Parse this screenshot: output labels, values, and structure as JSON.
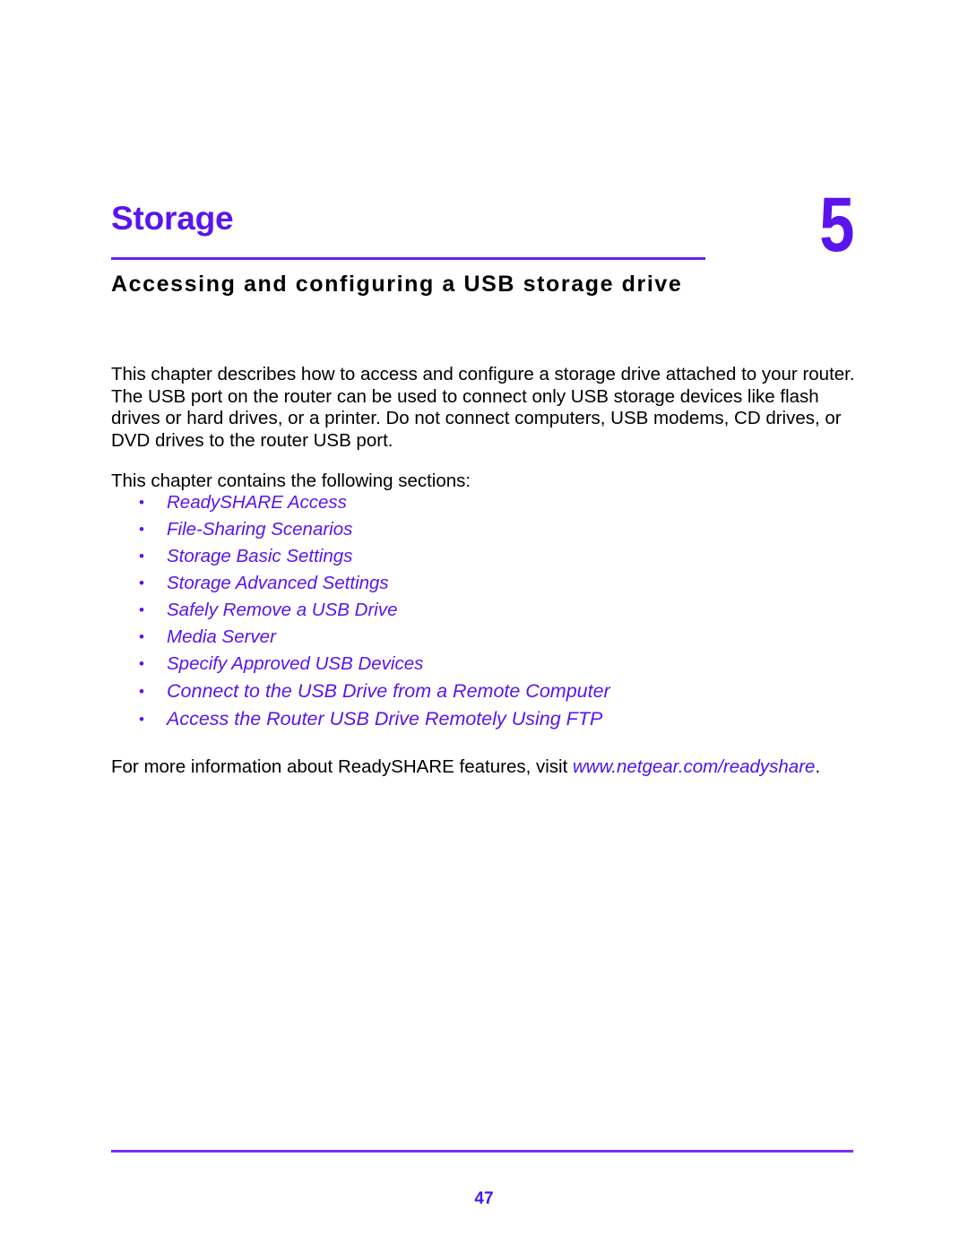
{
  "chapter": {
    "title": "Storage",
    "number": "5",
    "subtitle": "Accessing and configuring a USB storage drive"
  },
  "intro": {
    "paragraph": "This chapter describes how to access and configure a storage drive attached to your router. The USB port on the router can be used to connect only USB storage devices like flash drives or hard drives, or a printer. Do not connect computers, USB modems, CD drives, or DVD drives to the router USB port.",
    "contains_line": "This chapter contains the following sections:"
  },
  "bullet_glyph": "•",
  "sections": [
    {
      "label": "ReadySHARE Access"
    },
    {
      "label": "File-Sharing Scenarios"
    },
    {
      "label": "Storage Basic Settings"
    },
    {
      "label": "Storage Advanced Settings"
    },
    {
      "label": "Safely Remove a USB Drive"
    },
    {
      "label": "Media Server"
    },
    {
      "label": "Specify Approved USB Devices"
    },
    {
      "label": "Connect to the USB Drive from a Remote Computer"
    },
    {
      "label": "Access the Router USB Drive Remotely Using FTP"
    }
  ],
  "closing": {
    "prefix": "For more information about ReadySHARE features, visit ",
    "link": "www.netgear.com/readyshare",
    "suffix": "."
  },
  "footer": {
    "page_number": "47"
  },
  "colors": {
    "accent_purple": "#5a15ec",
    "rule_purple": "#6a22f0",
    "footer_rule_purple": "#7a30f8",
    "text_black": "#000000",
    "background": "#ffffff"
  }
}
